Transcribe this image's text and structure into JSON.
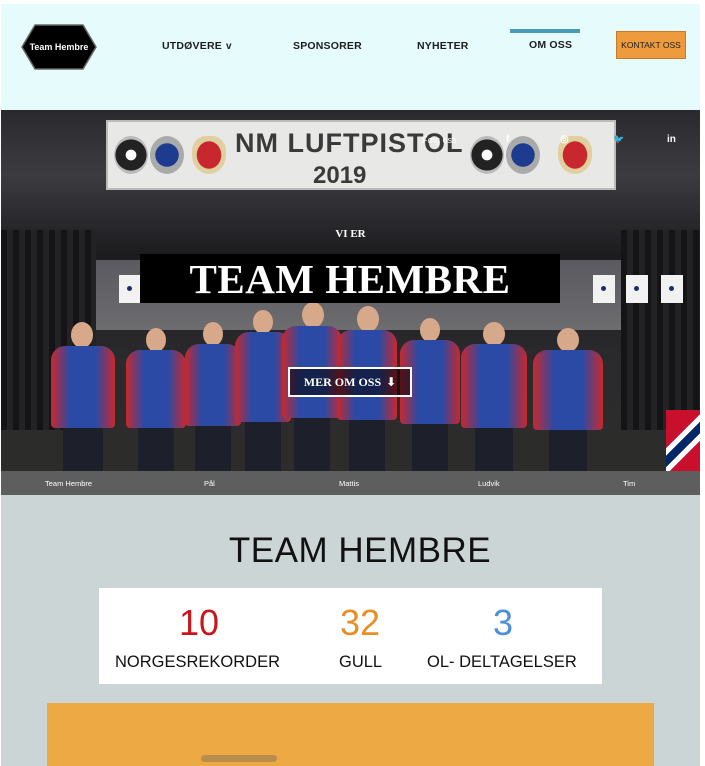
{
  "header": {
    "logo_text": "Team Hembre",
    "nav": [
      {
        "label": "UTDØVERE",
        "has_dropdown": true,
        "dropdown_glyph": "v"
      },
      {
        "label": "SPONSORER"
      },
      {
        "label": "NYHETER"
      },
      {
        "label": "OM OSS",
        "active": true
      }
    ],
    "cta_label": "KONTAKT OSS",
    "colors": {
      "background": "#e6fbfb",
      "active_indicator": "#4a9bb5",
      "cta": "#ee9b3d"
    }
  },
  "hero": {
    "banner_title": "NM LUFTPISTOL",
    "banner_year": "2019",
    "social": {
      "small_text": "Følg oss",
      "facebook_glyph": "f",
      "instagram_glyph": "◎",
      "twitter_glyph": "🐦",
      "linkedin_glyph": "in"
    },
    "kicker": "VI ER",
    "title": "TEAM HEMBRE",
    "button_label": "MER OM OSS",
    "button_icon": "arrow-down-icon"
  },
  "strip": {
    "items": [
      "Team Hembre",
      "Pål",
      "Mattis",
      "Ludvik",
      "Tim"
    ]
  },
  "stats": {
    "title": "TEAM HEMBRE",
    "items": [
      {
        "value": "10",
        "label": "NORGESREKORDER",
        "color": "#c8161d"
      },
      {
        "value": "32",
        "label": "GULL",
        "color": "#e58f28"
      },
      {
        "value": "3",
        "label": "OL- DELTAGELSER",
        "color": "#4a90d9"
      }
    ],
    "colors": {
      "background": "#cbd5d6",
      "block": "#eca944"
    }
  }
}
